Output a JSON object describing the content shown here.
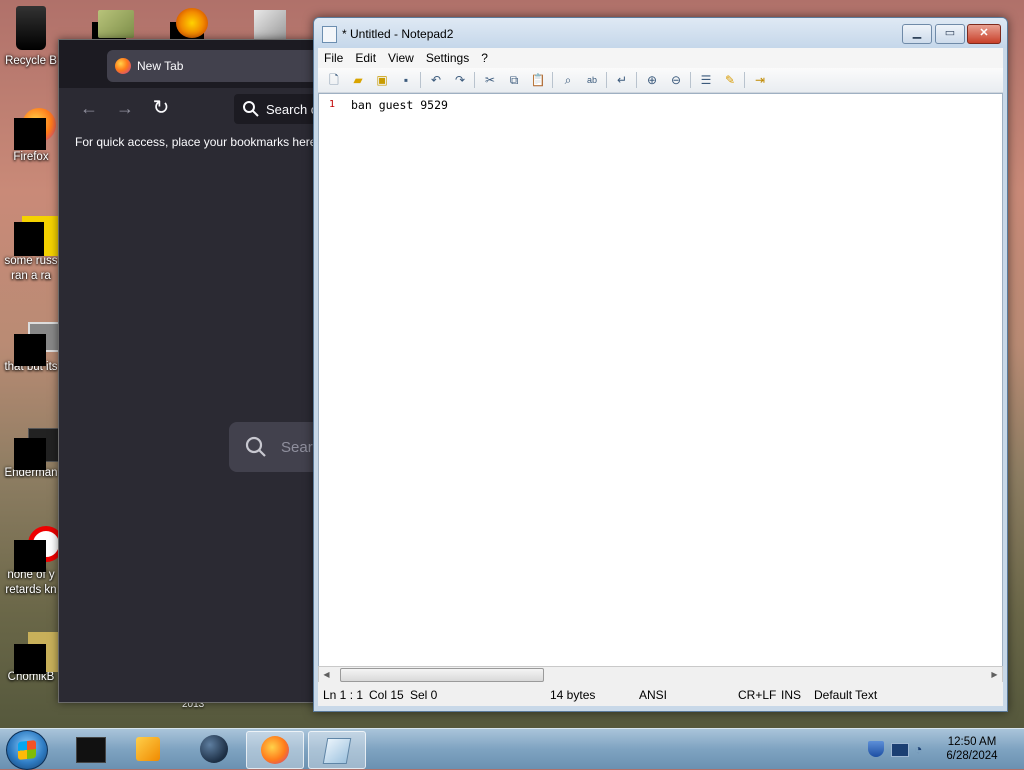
{
  "desktop": {
    "icons": [
      {
        "label": "Recycle B"
      },
      {
        "label": "Firefox"
      },
      {
        "label": "some russ\nran a ra"
      },
      {
        "label": "that but its"
      },
      {
        "label": "Enderman"
      },
      {
        "label": "none of y\nretards kn"
      },
      {
        "label": "ChomikB"
      }
    ],
    "year_label": "2013"
  },
  "firefox": {
    "tab_title": "New Tab",
    "tab_close": "×",
    "back": "←",
    "forward": "→",
    "reload": "↻",
    "url_placeholder": "Search or",
    "bookmarks_text": "For quick access, place your bookmarks here",
    "content_search_placeholder": "Search"
  },
  "notepad": {
    "title": "* Untitled - Notepad2",
    "menu": [
      "File",
      "Edit",
      "View",
      "Settings",
      "?"
    ],
    "gutter_line": "1",
    "text_line": "ban guest 9529",
    "status": {
      "position": "Ln 1 : 1",
      "col": "Col 15",
      "sel": "Sel 0",
      "size": "14 bytes",
      "encoding": "ANSI",
      "eol": "CR+LF",
      "mode": "INS",
      "scheme": "Default Text"
    }
  },
  "taskbar": {
    "clock_time": "12:50 AM",
    "clock_date": "6/28/2024"
  },
  "colors": {
    "firefox_bg": "#2b2a33",
    "notepad_frame": "#c8d8e8",
    "taskbar": "#7fa3c1"
  }
}
